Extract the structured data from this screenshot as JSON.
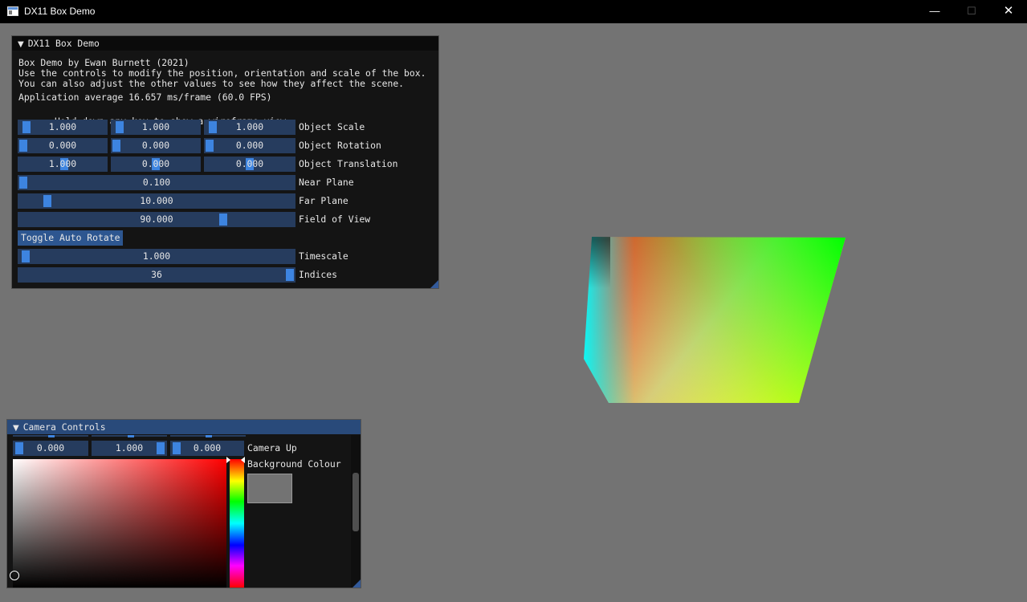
{
  "window": {
    "title": "DX11 Box Demo",
    "icon": "app-window-icon",
    "minimize_glyph": "—",
    "maximize_glyph": "☐",
    "close_glyph": "✕"
  },
  "demo_panel": {
    "title": "DX11 Box Demo",
    "collapse_glyph": "▼",
    "line1": "Box Demo by Ewan Burnett (2021)",
    "line2": "Use the controls to modify the position, orientation and scale of the box.",
    "line3": "You can also adjust the other values to see how they affect the scene.",
    "line4": "Application average 16.657 ms/frame (60.0 FPS)",
    "bullet": "•",
    "hint": "Hold down any key to show a wireframe view.",
    "scale": {
      "label": "Object Scale",
      "x": "1.000",
      "y": "1.000",
      "z": "1.000"
    },
    "rotation": {
      "label": "Object Rotation",
      "x": "0.000",
      "y": "0.000",
      "z": "0.000"
    },
    "translation": {
      "label": "Object Translation",
      "x": "1.000",
      "y": "0.000",
      "z": "0.000"
    },
    "near_plane": {
      "label": "Near Plane",
      "value": "0.100"
    },
    "far_plane": {
      "label": "Far Plane",
      "value": "10.000"
    },
    "fov": {
      "label": "Field of View",
      "value": "90.000"
    },
    "toggle_label": "Toggle Auto Rotate",
    "timescale": {
      "label": "Timescale",
      "value": "1.000"
    },
    "indices": {
      "label": "Indices",
      "value": "36"
    }
  },
  "camera_panel": {
    "title": "Camera Controls",
    "collapse_glyph": "▼",
    "up": {
      "label": "Camera Up",
      "x": "0.000",
      "y": "1.000",
      "z": "0.000"
    },
    "bg_label": "Background Colour",
    "bg_color": "#737373"
  },
  "colors": {
    "viewport_bg": "#737373",
    "slider_frame": "#263c5e",
    "slider_grab": "#3d84e0",
    "button": "#2d5690",
    "camera_title": "#294a7a"
  }
}
